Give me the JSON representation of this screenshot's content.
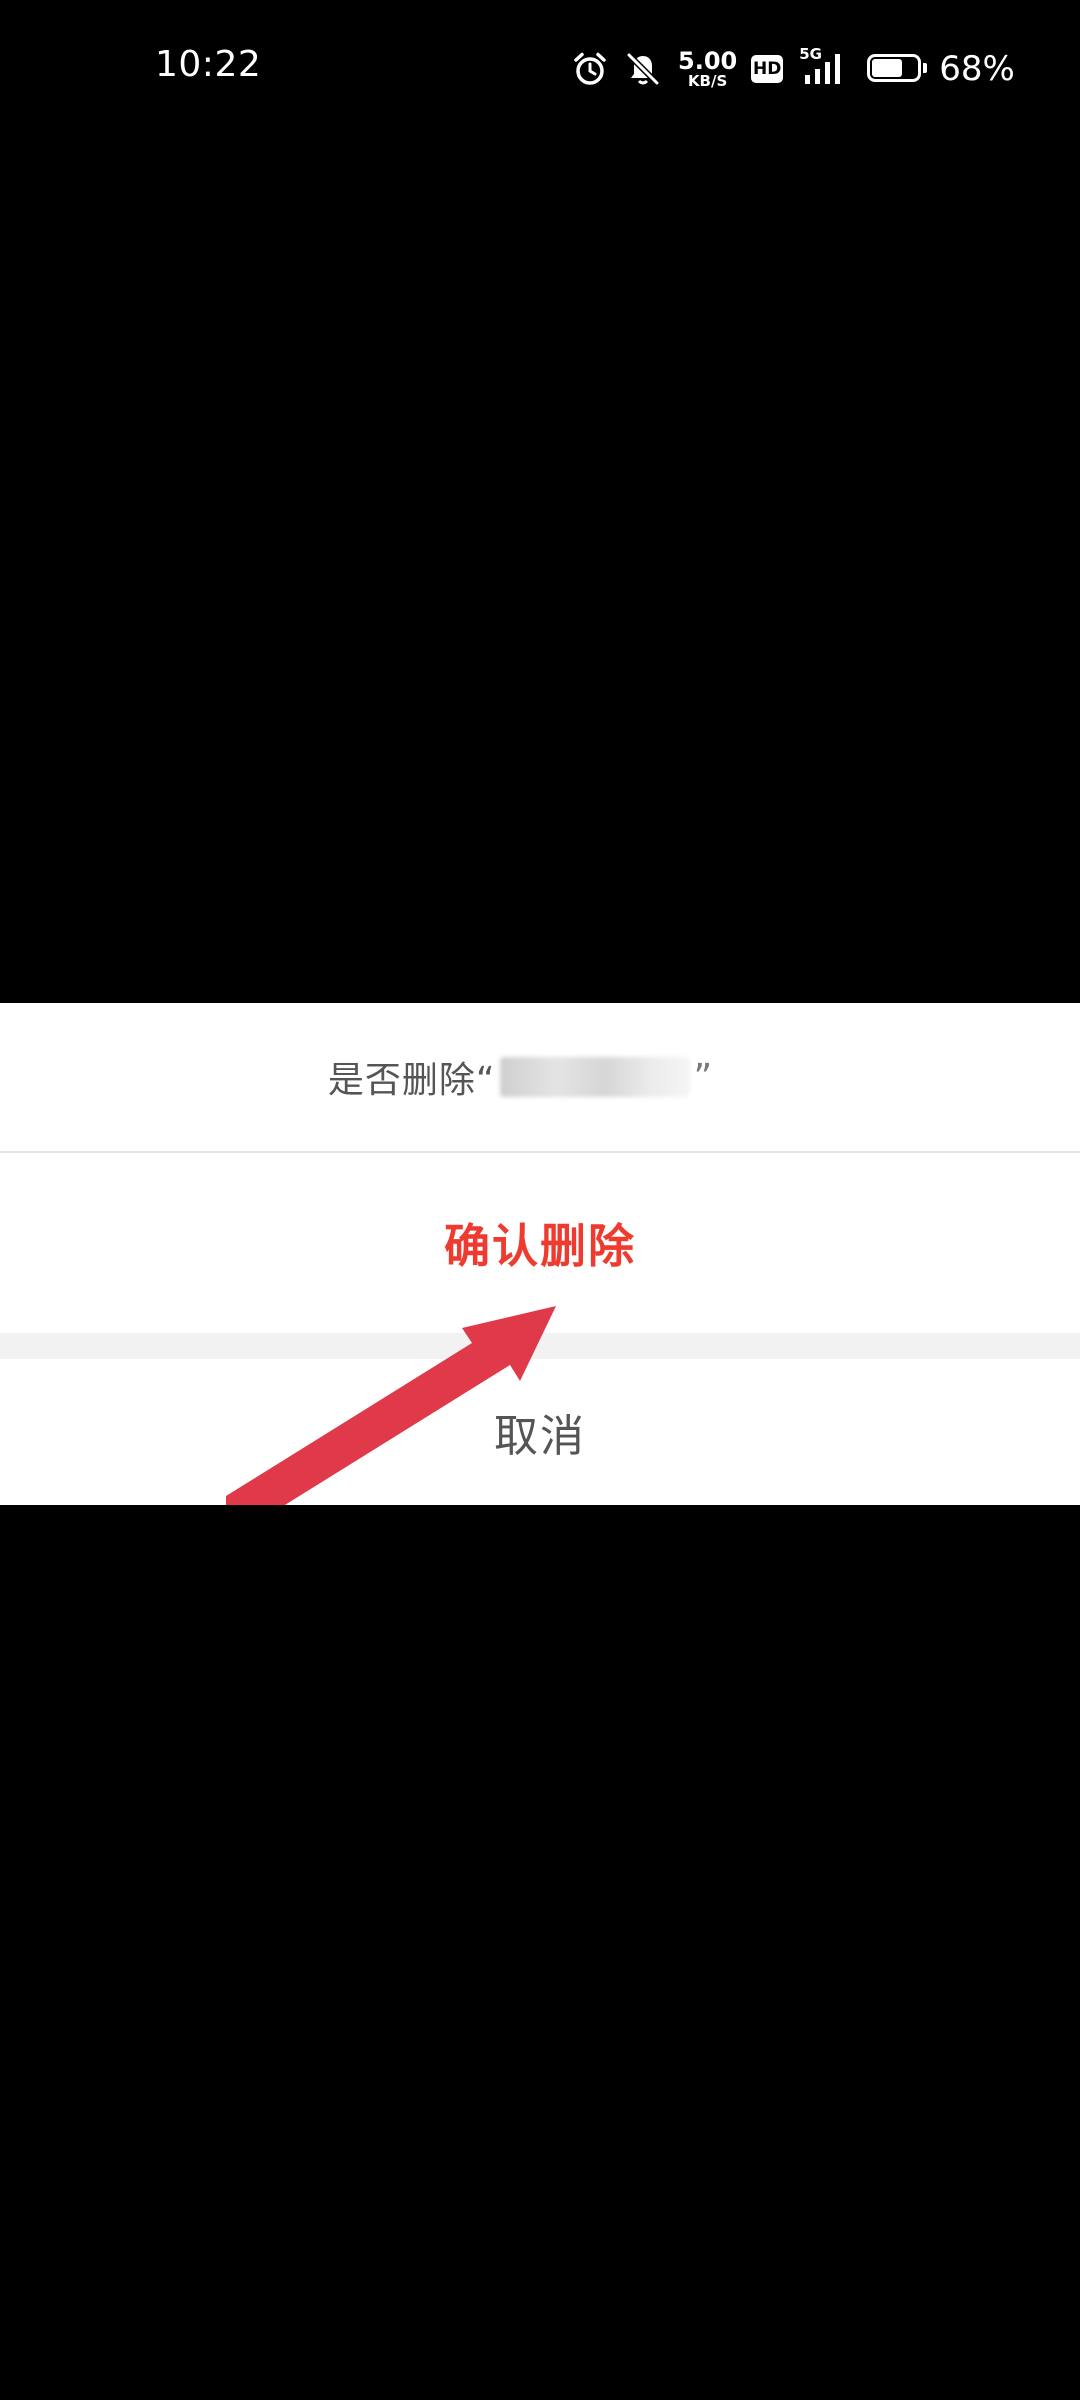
{
  "status_bar": {
    "time": "10:22",
    "net_speed_value": "5.00",
    "net_speed_unit": "KB/S",
    "hd_label": "HD",
    "network_type": "5G",
    "battery_percent": "68%",
    "battery_level": 0.68,
    "icons": [
      "alarm-icon",
      "bell-muted-icon",
      "signal-icon",
      "battery-icon"
    ]
  },
  "dialog": {
    "message_prefix": "是否删除“",
    "message_suffix": "”",
    "confirm_label": "确认删除",
    "cancel_label": "取消"
  },
  "annotation": {
    "arrow_icon": "red-arrow-icon"
  },
  "colors": {
    "background": "#000000",
    "sheet": "#ffffff",
    "confirm": "#ef3b2f",
    "cancel_text": "#555555",
    "arrow": "#e03a4a"
  }
}
